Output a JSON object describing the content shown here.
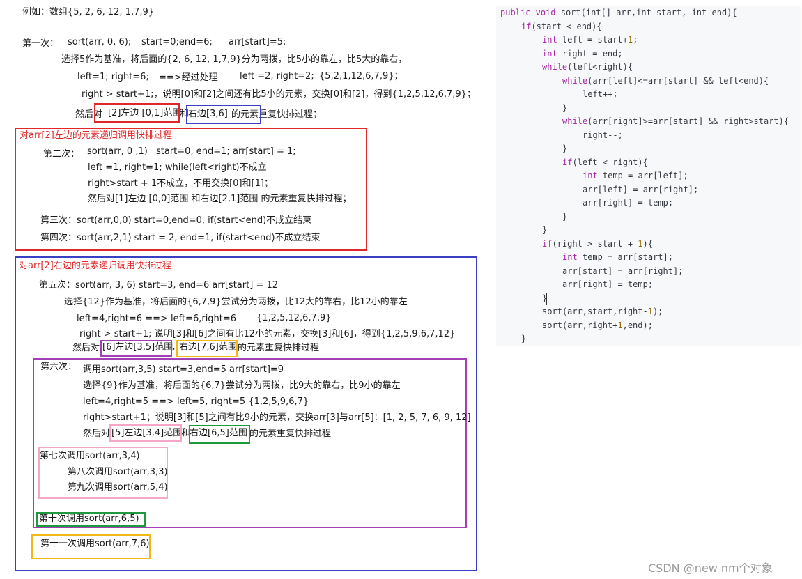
{
  "notes": {
    "example": "例如：数组{5, 2, 6, 12, 1,7,9}",
    "p1": {
      "label": "第一次：",
      "call": "sort(arr, 0, 6);",
      "range": "start=0;end=6;",
      "pivot": "arr[start]=5;",
      "line2": "选择5作为基准，将后面的{2, 6, 12, 1,7,9}分为两拨，比5小的靠左，比5大的靠右，",
      "line3a": "left=1; right=6;",
      "line3b": "==>经过处理",
      "line3c": "left =2, right=2;",
      "line3d": "{5,2,1,12,6,7,9}；",
      "line4": "right > start+1;，说明[0]和[2]之间还有比5小的元素，交换[0]和[2]，得到{1,2,5,12,6,7,9}；",
      "line5a": "然后对",
      "line5b": "[2]左边 [0,1]范围",
      "line5c": "和",
      "line5d": "右边[3,6]",
      "line5e": "的元素重复快排过程；"
    },
    "left_section": {
      "title": "对arr[2]左边的元素递归调用快排过程",
      "p2_label": "第二次：",
      "p2_call": "sort(arr, 0 ,1)",
      "p2_range": "start=0, end=1;",
      "p2_pivot": "arr[start] = 1;",
      "p2_line2": "left =1, right=1;   while(left<right)不成立",
      "p2_line3": "right>start + 1不成立，不用交换[0]和[1]；",
      "p2_line4": "然后对[1]左边 [0,0]范围 和右边[2,1]范围  的元素重复快排过程；",
      "p3": "第三次：sort(arr,0,0)  start=0,end=0, if(start<end)不成立结束",
      "p4": "第四次：sort(arr,2,1)   start = 2, end=1, if(start<end)不成立结束"
    },
    "right_section": {
      "title": "对arr[2]右边的元素递归调用快排过程",
      "p5_line1": "第五次：sort(arr, 3, 6)  start=3, end=6  arr[start] = 12",
      "p5_line2": "选择{12}作为基准，将后面的{6,7,9}尝试分为两拨，比12大的靠右，比12小的靠左",
      "p5_line3a": "left=4,right=6  ==>  left=6,right=6",
      "p5_line3b": "{1,2,5,12,6,7,9}",
      "p5_line4": "right > start+1;   说明[3]和[6]之间有比12小的元素，交换[3]和[6]，得到{1,2,5,9,6,7,12}",
      "p5_line5a": "然后对",
      "p5_line5b": "[6]左边[3,5]范围",
      "p5_line5c": "，",
      "p5_line5d": "右边[7,6]范围",
      "p5_line5e": "的元素重复快排过程",
      "p6_label": "第六次：",
      "p6_line1": "调用sort(arr,3,5)  start=3,end=5   arr[start]=9",
      "p6_line2": "选择{9}作为基准，将后面的{6,7}尝试分为两拨，比9大的靠右，比9小的靠左",
      "p6_line3": "left=4,right=5 ==> left=5, right=5   {1,2,5,9,6,7}",
      "p6_line4": "right>start+1；说明[3]和[5]之间有比9小的元素，交换arr[3]与arr[5]：[1, 2, 5, 7, 6, 9, 12]",
      "p6_line5a": "然后对",
      "p6_line5b": "[5]左边[3,4]范围",
      "p6_line5c": "和",
      "p6_line5d": "右边[6,5]范围",
      "p6_line5e": "的元素重复快排过程",
      "p7": "第七次调用sort(arr,3,4)",
      "p8": "第八次调用sort(arr,3,3)",
      "p9": "第九次调用sort(arr,5,4)",
      "p10": "第十次调用sort(arr,6,5)",
      "p11": "第十一次调用sort(arr,7,6)"
    }
  },
  "code": {
    "l1": "public void sort(int[] arr,int start, int end){",
    "l2": "if(start < end){",
    "l3": "int left = start+1;",
    "l4": "int right = end;",
    "l5": "while(left<right){",
    "l6": "while(arr[left]<=arr[start] && left<end){",
    "l7": "left++;",
    "l8": "}",
    "l9": "while(arr[right]>=arr[start] && right>start){",
    "l10": "right--;",
    "l11": "}",
    "l12": "if(left < right){",
    "l13": "int temp = arr[left];",
    "l14": "arr[left] = arr[right];",
    "l15": "arr[right] = temp;",
    "l16": "}",
    "l17": "}",
    "l18": "if(right > start + 1){",
    "l19": "int temp = arr[start];",
    "l20": "arr[start] = arr[right];",
    "l21": "arr[right] = temp;",
    "l22": "}",
    "l23": "sort(arr,start,right-1);",
    "l24": "sort(arr,right+1,end);",
    "l25": "}"
  },
  "watermark": "CSDN @new nm个对象",
  "colors": {
    "red": "#e0282a",
    "blue": "#3b3fc2",
    "purple": "#a23fb5",
    "pink": "#f4a7c7",
    "green": "#1e9a3c",
    "orange": "#f2b817"
  }
}
